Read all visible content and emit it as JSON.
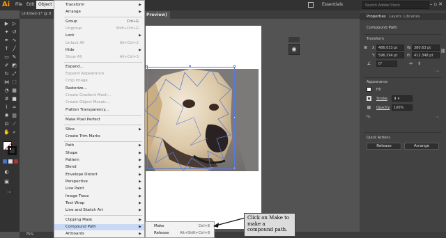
{
  "menubar": {
    "app_logo": "Ai",
    "items": [
      "File",
      "Edit",
      "Object"
    ],
    "workspace": "Essentials",
    "stock_search_placeholder": "Search Adobe Stock"
  },
  "tabs": {
    "doc_left": "Untitled-1* @ 8",
    "doc_right": "Preview)"
  },
  "object_menu": {
    "items": [
      {
        "label": "Transform",
        "arrow": true
      },
      {
        "label": "Arrange",
        "arrow": true
      },
      {
        "label": "Group",
        "shortcut": "Ctrl+G"
      },
      {
        "label": "Ungroup",
        "shortcut": "Shift+Ctrl+G",
        "disabled": true
      },
      {
        "label": "Lock",
        "arrow": true
      },
      {
        "label": "Unlock All",
        "shortcut": "Alt+Ctrl+2",
        "disabled": true
      },
      {
        "label": "Hide",
        "arrow": true
      },
      {
        "label": "Show All",
        "shortcut": "Alt+Ctrl+3",
        "disabled": true
      },
      {
        "label": "Expand..."
      },
      {
        "label": "Expand Appearance",
        "disabled": true
      },
      {
        "label": "Crop Image",
        "disabled": true
      },
      {
        "label": "Rasterize..."
      },
      {
        "label": "Create Gradient Mesh...",
        "disabled": true
      },
      {
        "label": "Create Object Mosaic...",
        "disabled": true
      },
      {
        "label": "Flatten Transparency..."
      },
      {
        "label": "Make Pixel Perfect"
      },
      {
        "label": "Slice",
        "arrow": true
      },
      {
        "label": "Create Trim Marks"
      },
      {
        "label": "Path",
        "arrow": true
      },
      {
        "label": "Shape",
        "arrow": true
      },
      {
        "label": "Pattern",
        "arrow": true
      },
      {
        "label": "Blend",
        "arrow": true
      },
      {
        "label": "Envelope Distort",
        "arrow": true
      },
      {
        "label": "Perspective",
        "arrow": true
      },
      {
        "label": "Live Paint",
        "arrow": true
      },
      {
        "label": "Image Trace",
        "arrow": true
      },
      {
        "label": "Text Wrap",
        "arrow": true
      },
      {
        "label": "Line and Sketch Art",
        "arrow": true
      },
      {
        "label": "Clipping Mask",
        "arrow": true
      },
      {
        "label": "Compound Path",
        "arrow": true,
        "highlighted": true
      },
      {
        "label": "Artboards",
        "arrow": true
      }
    ]
  },
  "compound_submenu": {
    "items": [
      {
        "label": "Make",
        "shortcut": "Ctrl+8"
      },
      {
        "label": "Release",
        "shortcut": "Alt+Shift+Ctrl+8"
      }
    ]
  },
  "properties": {
    "tabs": [
      "Properties",
      "Layers",
      "Libraries"
    ],
    "selection_label": "Compound Path",
    "transform_heading": "Transform",
    "x_label": "X:",
    "x_value": "486.033 pt",
    "w_label": "W:",
    "w_value": "380.63 pt",
    "y_label": "Y:",
    "y_value": "596.294 pt",
    "h_label": "H:",
    "h_value": "412.348 pt",
    "angle_value": "0°",
    "appearance_heading": "Appearance",
    "fill_label": "Fill",
    "stroke_label": "Stroke",
    "opacity_label": "Opacity",
    "opacity_value": "100%",
    "fx_label": "fx.",
    "quick_actions_heading": "Quick Actions",
    "release_button": "Release",
    "arrange_button": "Arrange"
  },
  "status": {
    "zoom": "75%"
  },
  "callout": {
    "text": "Click on Make to make a compound path."
  },
  "colors": {
    "menu_highlight": "#c7d9f4",
    "selection_blue": "#5b7ad6",
    "app_orange": "#ff9a00"
  }
}
